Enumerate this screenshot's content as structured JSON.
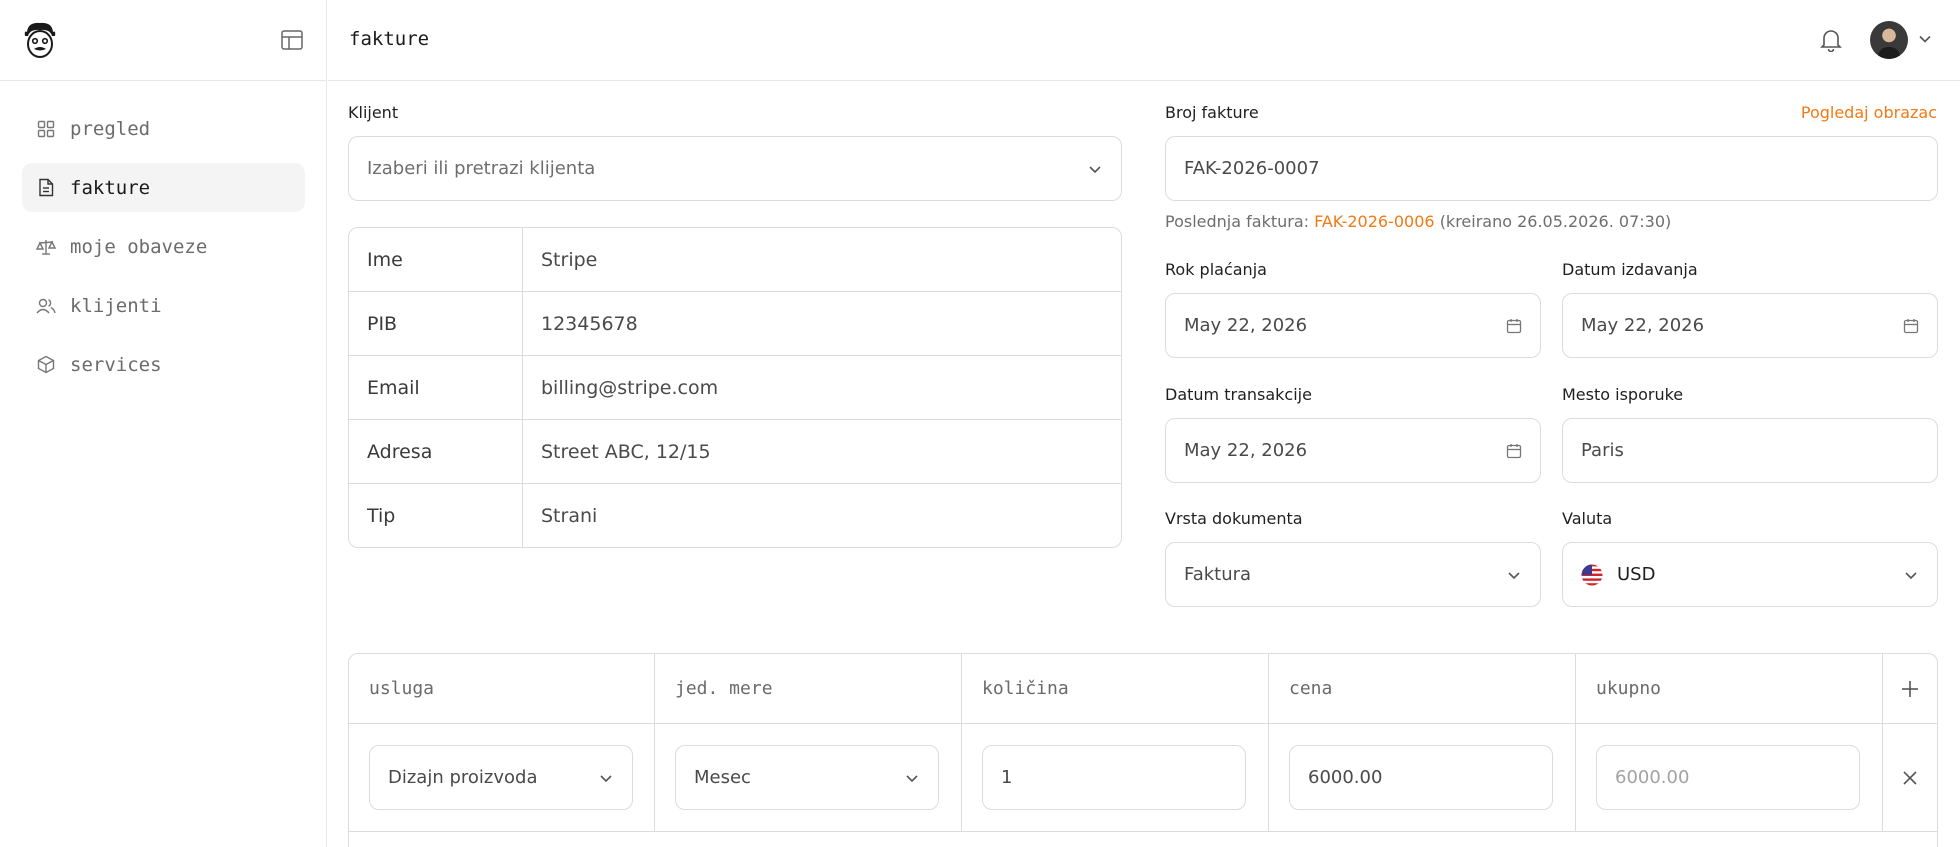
{
  "page": {
    "title": "fakture"
  },
  "sidebar": {
    "items": [
      {
        "label": "pregled",
        "icon": "grid-icon",
        "active": false
      },
      {
        "label": "fakture",
        "icon": "document-icon",
        "active": true
      },
      {
        "label": "moje obaveze",
        "icon": "scale-icon",
        "active": false
      },
      {
        "label": "klijenti",
        "icon": "users-icon",
        "active": false
      },
      {
        "label": "services",
        "icon": "box-icon",
        "active": false
      }
    ]
  },
  "client": {
    "label": "Klijent",
    "placeholder": "Izaberi ili pretrazi klijenta",
    "rows": [
      {
        "key": "Ime",
        "value": "Stripe"
      },
      {
        "key": "PIB",
        "value": "12345678"
      },
      {
        "key": "Email",
        "value": "billing@stripe.com"
      },
      {
        "key": "Adresa",
        "value": "Street ABC, 12/15"
      },
      {
        "key": "Tip",
        "value": "Strani"
      }
    ]
  },
  "invoice": {
    "number_label": "Broj fakture",
    "view_form_link": "Pogledaj obrazac",
    "number_value": "FAK-2026-0007",
    "last_prefix": "Poslednja faktura:",
    "last_number": "FAK-2026-0006",
    "last_created": "(kreirano 26.05.2026. 07:30)",
    "due_label": "Rok plaćanja",
    "due_value": "May 22, 2026",
    "issue_label": "Datum izdavanja",
    "issue_value": "May 22, 2026",
    "transaction_label": "Datum transakcije",
    "transaction_value": "May 22, 2026",
    "delivery_label": "Mesto isporuke",
    "delivery_value": "Paris",
    "doctype_label": "Vrsta dokumenta",
    "doctype_value": "Faktura",
    "currency_label": "Valuta",
    "currency_value": "USD"
  },
  "items": {
    "headers": [
      "usluga",
      "jed. mere",
      "količina",
      "cena",
      "ukupno"
    ],
    "rows": [
      {
        "service": "Dizajn proizvoda",
        "unit": "Mesec",
        "quantity": "1",
        "price": "6000.00",
        "total": "6000.00"
      }
    ]
  },
  "colors": {
    "accent": "#f07a14",
    "border": "#dcdcdc",
    "active_bg": "#f4f4f4"
  }
}
